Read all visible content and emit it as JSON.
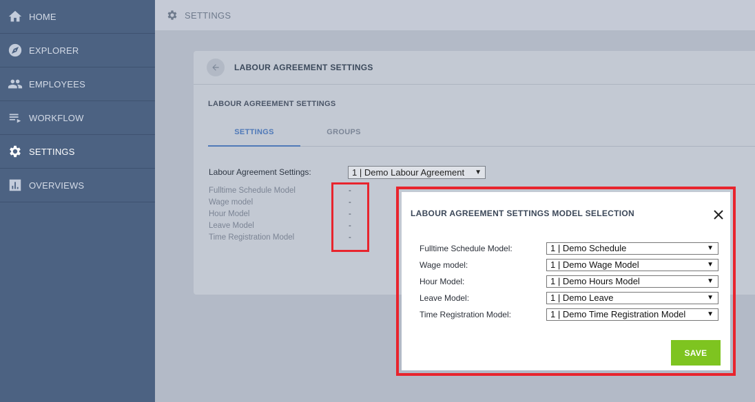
{
  "sidebar": {
    "items": [
      {
        "label": "HOME",
        "icon": "home-icon"
      },
      {
        "label": "EXPLORER",
        "icon": "compass-icon"
      },
      {
        "label": "EMPLOYEES",
        "icon": "people-icon"
      },
      {
        "label": "WORKFLOW",
        "icon": "list-icon"
      },
      {
        "label": "SETTINGS",
        "icon": "gear-icon"
      },
      {
        "label": "OVERVIEWS",
        "icon": "bar-chart-icon"
      }
    ]
  },
  "topbar": {
    "title": "SETTINGS",
    "icon": "gear-icon"
  },
  "card": {
    "title": "LABOUR AGREEMENT SETTINGS",
    "section_title": "LABOUR AGREEMENT SETTINGS",
    "tabs": [
      {
        "label": "SETTINGS"
      },
      {
        "label": "GROUPS"
      }
    ],
    "la_label": "Labour Agreement Settings:",
    "la_value": "1 | Demo Labour Agreement",
    "fields": [
      {
        "label": "Fulltime Schedule Model",
        "value": "-"
      },
      {
        "label": "Wage model",
        "value": "-"
      },
      {
        "label": "Hour Model",
        "value": "-"
      },
      {
        "label": "Leave Model",
        "value": "-"
      },
      {
        "label": "Time Registration Model",
        "value": "-"
      }
    ]
  },
  "modal": {
    "title": "LABOUR AGREEMENT SETTINGS MODEL SELECTION",
    "rows": [
      {
        "label": "Fulltime Schedule Model:",
        "value": "1 | Demo Schedule"
      },
      {
        "label": "Wage model:",
        "value": "1 | Demo Wage Model"
      },
      {
        "label": "Hour Model:",
        "value": "1 | Demo Hours Model"
      },
      {
        "label": "Leave Model:",
        "value": "1 | Demo Leave"
      },
      {
        "label": "Time Registration Model:",
        "value": "1 | Demo Time Registration Model"
      }
    ],
    "save_label": "SAVE"
  },
  "colors": {
    "sidebar": "#4c6282",
    "accent": "#4f79b8",
    "save": "#7ec420",
    "highlight": "#e8242d"
  }
}
